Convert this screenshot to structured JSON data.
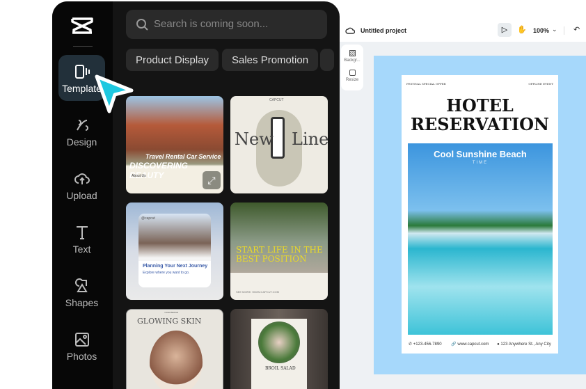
{
  "sidebar": {
    "items": [
      {
        "label": "Template",
        "icon": "template-icon"
      },
      {
        "label": "Design",
        "icon": "design-icon"
      },
      {
        "label": "Upload",
        "icon": "upload-icon"
      },
      {
        "label": "Text",
        "icon": "text-icon"
      },
      {
        "label": "Shapes",
        "icon": "shapes-icon"
      },
      {
        "label": "Photos",
        "icon": "photos-icon"
      }
    ]
  },
  "panel": {
    "search_placeholder": "Search is coming soon...",
    "chips": [
      "Product Display",
      "Sales Promotion"
    ],
    "cards": [
      {
        "title": "DISCOVERING BEAUTY",
        "subtitle": "Travel Rental Car Service",
        "extra": "About Us"
      },
      {
        "title": "New",
        "title2": "Line",
        "extra": "CAPCUT"
      },
      {
        "title": "Planning Your Next Journey",
        "subtitle": "Explore where you want to go.",
        "extra": "@capcut"
      },
      {
        "title": "START LIFE IN THE BEST POSITION",
        "subtitle": "SEE MORE: WWW.CAPCUT.COM"
      },
      {
        "title": "GLOWING SKIN",
        "extra": "YOUR BRAND"
      },
      {
        "title": "BROIL SALAD"
      }
    ]
  },
  "editor": {
    "project_title": "Untitled project",
    "zoom": "100%",
    "tools": [
      "Backgr...",
      "Resize"
    ],
    "poster": {
      "top_left": "FESTIVAL SPECIAL OFFER",
      "top_right": "OFFLINE EVENT",
      "title1": "HOTEL",
      "title2": "RESERVATION",
      "headline": "Cool Sunshine Beach",
      "sub": "TIME",
      "phone": "+123-456-7890",
      "web": "www.capcut.com",
      "address": "123 Anywhere St., Any City"
    }
  },
  "colors": {
    "accent_cursor": "#1ec8e0",
    "frame": "#a6d8fb"
  }
}
